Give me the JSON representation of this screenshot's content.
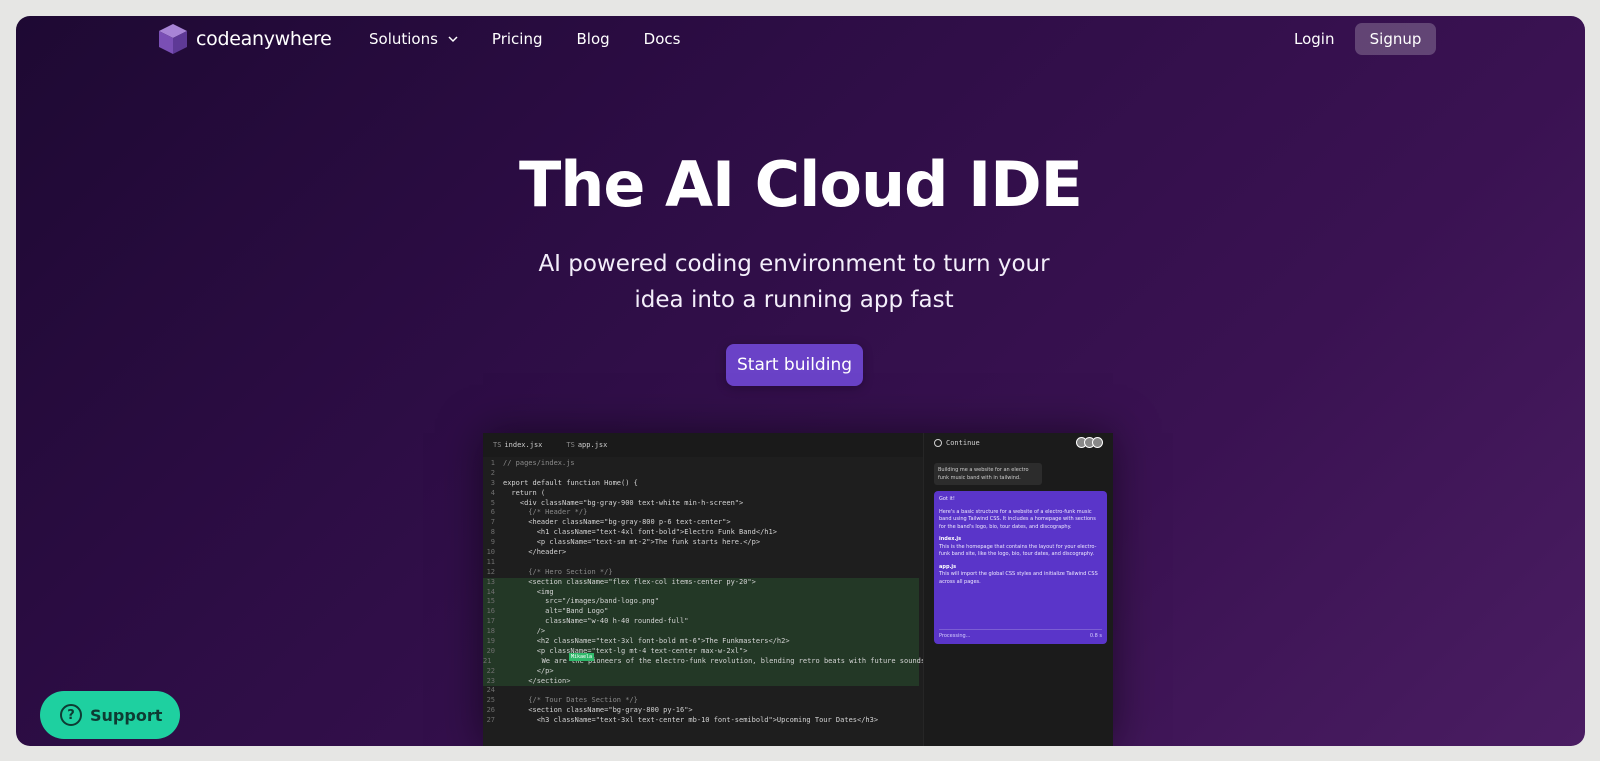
{
  "brand": {
    "name": "codeanywhere",
    "icon": "cube-logo-icon",
    "color": "#8e63c7"
  },
  "nav": {
    "links": [
      {
        "label": "Solutions",
        "has_dropdown": true
      },
      {
        "label": "Pricing"
      },
      {
        "label": "Blog"
      },
      {
        "label": "Docs"
      }
    ],
    "login": "Login",
    "signup": "Signup"
  },
  "hero": {
    "title": "The AI Cloud IDE",
    "subtitle_line1": "AI powered coding environment to turn your",
    "subtitle_line2": "idea into a running app fast",
    "cta": "Start building",
    "cta_color": "#6a42c7"
  },
  "editor": {
    "tabs": [
      {
        "prefix": "TS",
        "label": "index.jsx"
      },
      {
        "prefix": "TS",
        "label": "app.jsx"
      }
    ],
    "lines": [
      {
        "n": "1",
        "text": "// pages/index.js"
      },
      {
        "n": "2",
        "text": ""
      },
      {
        "n": "3",
        "text": "export default function Home() {"
      },
      {
        "n": "4",
        "text": "  return ("
      },
      {
        "n": "5",
        "text": "    <div className=\"bg-gray-900 text-white min-h-screen\">"
      },
      {
        "n": "6",
        "text": "      {/* Header */}"
      },
      {
        "n": "7",
        "text": "      <header className=\"bg-gray-800 p-6 text-center\">"
      },
      {
        "n": "8",
        "text": "        <h1 className=\"text-4xl font-bold\">Electro Funk Band</h1>"
      },
      {
        "n": "9",
        "text": "        <p className=\"text-sm mt-2\">The funk starts here.</p>"
      },
      {
        "n": "10",
        "text": "      </header>"
      },
      {
        "n": "11",
        "text": ""
      },
      {
        "n": "12",
        "text": "      {/* Hero Section */}"
      },
      {
        "n": "13",
        "text": "      <section className=\"flex flex-col items-center py-20\">"
      },
      {
        "n": "14",
        "text": "        <img"
      },
      {
        "n": "15",
        "text": "          src=\"/images/band-logo.png\""
      },
      {
        "n": "16",
        "text": "          alt=\"Band Logo\""
      },
      {
        "n": "17",
        "text": "          className=\"w-40 h-40 rounded-full\""
      },
      {
        "n": "18",
        "text": "        />"
      },
      {
        "n": "19",
        "text": "        <h2 className=\"text-3xl font-bold mt-6\">The Funkmasters</h2>"
      },
      {
        "n": "20",
        "text": "        <p className=\"text-lg mt-4 text-center max-w-2xl\">"
      },
      {
        "n": "21",
        "text": "          We are the pioneers of the electro-funk revolution, blending retro beats with future sounds."
      },
      {
        "n": "22",
        "text": "        </p>"
      },
      {
        "n": "23",
        "text": "      </section>"
      },
      {
        "n": "24",
        "text": ""
      },
      {
        "n": "25",
        "text": "      {/* Tour Dates Section */}"
      },
      {
        "n": "26",
        "text": "      <section className=\"bg-gray-800 py-16\">"
      },
      {
        "n": "27",
        "text": "        <h3 className=\"text-3xl text-center mb-10 font-semibold\">Upcoming Tour Dates</h3>"
      }
    ],
    "highlight_from": 13,
    "highlight_to": 23,
    "badge": "Mikaela"
  },
  "chat": {
    "title": "Continue",
    "user_message": "Building me a website for an electro funk music band with in tailwind.",
    "ai_intro": "Got it!",
    "ai_body": "Here's a basic structure for a website of a electro-funk music band using Tailwind CSS. It includes a homepage with sections for the band's logo, bio, tour dates, and discography.",
    "file1_name": "index.js",
    "file1_desc": "This is the homepage that contains the layout for your electro-funk band site, like the logo, bio, tour dates, and discography.",
    "file2_name": "app.js",
    "file2_desc": "This will import the global CSS styles and initialize Tailwind CSS across all pages.",
    "status": "Processing...",
    "status_right": "0.8 s"
  },
  "support": {
    "label": "Support",
    "icon": "question-circle-icon",
    "color": "#1ed0a0"
  }
}
